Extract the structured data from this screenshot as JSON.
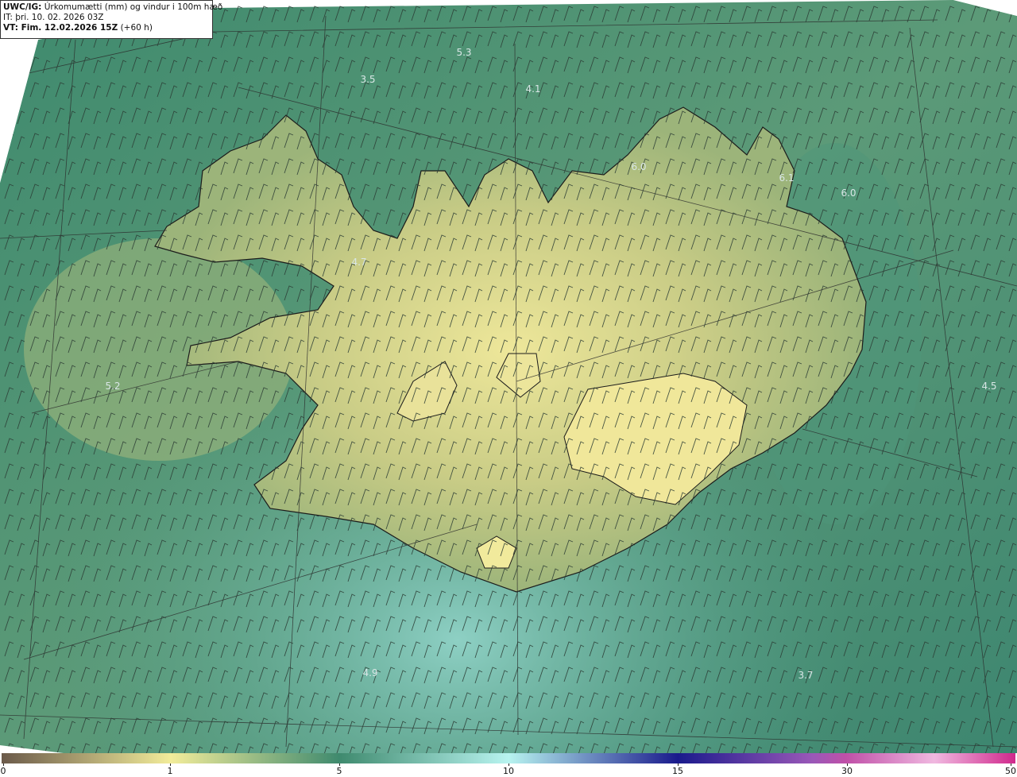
{
  "header": {
    "model_label": "UWC/IG:",
    "title": "Úrkomumætti (mm) og vindur i 100m hæð",
    "init_time": "IT: þri. 10. 02. 2026 03Z",
    "valid_label": "VT: Fim. 12.02.2026 15Z",
    "valid_offset": "(+60 h)"
  },
  "map": {
    "values": [
      {
        "text": "5.3",
        "pos": "north"
      },
      {
        "text": "3.5",
        "pos": "north-west sea"
      },
      {
        "text": "4.1",
        "pos": "north"
      },
      {
        "text": "6.0",
        "pos": "north-east"
      },
      {
        "text": "6.1",
        "pos": "north-east"
      },
      {
        "text": "6.0",
        "pos": "north-east sea"
      },
      {
        "text": "4.7",
        "pos": "west"
      },
      {
        "text": "5.2",
        "pos": "west sea"
      },
      {
        "text": "4.5",
        "pos": "east sea"
      },
      {
        "text": "4.9",
        "pos": "south sea"
      },
      {
        "text": "3.7",
        "pos": "south-east sea"
      }
    ]
  },
  "colorbar": {
    "ticks": [
      "0",
      "1",
      "5",
      "10",
      "15",
      "30",
      "50"
    ],
    "colors": {
      "c0": "#6b5a4a",
      "c1": "#f2ec9a",
      "c5": "#3f8a6e",
      "c10": "#b8f4f0",
      "c15": "#1a1a8c",
      "c30": "#c050a8",
      "c50": "#d0288c"
    }
  }
}
